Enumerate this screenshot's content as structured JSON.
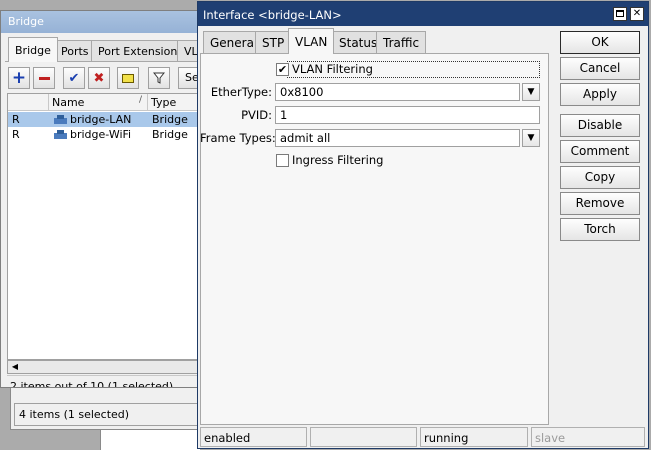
{
  "back_window": {
    "status": "4 items (1 selected)"
  },
  "bridge_window": {
    "title": "Bridge",
    "tabs": [
      "Bridge",
      "Ports",
      "Port Extensions",
      "VL"
    ],
    "find_label": "Se",
    "columns": {
      "flags": "",
      "name": "Name",
      "type": "Type"
    },
    "rows": [
      {
        "flag": "R",
        "name": "bridge-LAN",
        "type": "Bridge",
        "selected": true
      },
      {
        "flag": "R",
        "name": "bridge-WiFi",
        "type": "Bridge",
        "selected": false
      }
    ],
    "status": "2 items out of 10 (1 selected)",
    "toolbar_icons": [
      "add-icon",
      "remove-icon",
      "enable-icon",
      "disable-icon",
      "comment-icon",
      "filter-icon"
    ]
  },
  "dialog": {
    "title": "Interface <bridge-LAN>",
    "tabs": [
      "General",
      "STP",
      "VLAN",
      "Status",
      "Traffic"
    ],
    "active_tab": "VLAN",
    "vlan_filtering": {
      "label": "VLAN Filtering",
      "checked": true
    },
    "ethertype": {
      "label": "EtherType:",
      "value": "0x8100"
    },
    "pvid": {
      "label": "PVID:",
      "value": "1"
    },
    "frame_types": {
      "label": "Frame Types:",
      "value": "admit all"
    },
    "ingress_filtering": {
      "label": "Ingress Filtering",
      "checked": false
    },
    "buttons": {
      "ok": "OK",
      "cancel": "Cancel",
      "apply": "Apply",
      "disable": "Disable",
      "comment": "Comment",
      "copy": "Copy",
      "remove": "Remove",
      "torch": "Torch"
    },
    "status_bar": {
      "state": "enabled",
      "middle": "",
      "running": "running",
      "slave": "slave"
    }
  },
  "colors": {
    "dialog_title": "#1f3f73",
    "inactive_title": "#a9c2e0",
    "selection": "#a9c8ea",
    "add_icon": "#1a3fb0",
    "remove_icon": "#c02020"
  }
}
